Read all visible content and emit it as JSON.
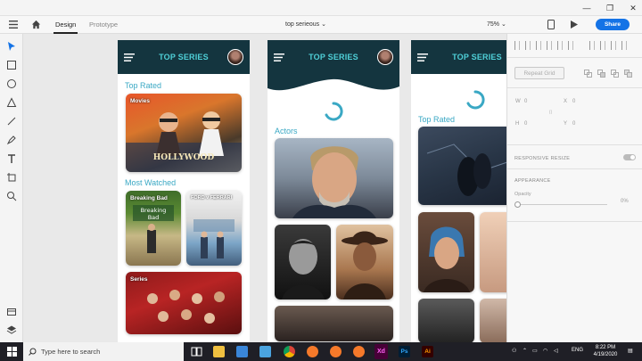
{
  "window": {
    "minimize_glyph": "—",
    "maximize_glyph": "❐",
    "close_glyph": "✕"
  },
  "app": {
    "tabs": [
      {
        "label": "Design",
        "active": true
      },
      {
        "label": "Prototype",
        "active": false
      }
    ],
    "document_title": "top serieous",
    "zoom": "75%",
    "share_label": "Share",
    "accent_color": "#1473e6"
  },
  "toolbar": {
    "tools": [
      "select-icon",
      "rectangle-icon",
      "ellipse-icon",
      "polygon-icon",
      "line-icon",
      "pen-icon",
      "text-icon",
      "artboard-icon",
      "zoom-icon",
      "plugins-icon",
      "layers-icon"
    ]
  },
  "artboards": [
    {
      "header_title": "TOP SERIES",
      "sections": [
        {
          "title": "Top Rated",
          "cards": [
            {
              "label": "Movies",
              "name": "movie-card-hollywood"
            }
          ]
        },
        {
          "title": "Most Watched",
          "cards": [
            {
              "label": "Breaking Bad",
              "name": "card-breaking-bad"
            },
            {
              "label": "FORD v FERRARI",
              "name": "card-ford-ferrari"
            }
          ]
        },
        {
          "title": "",
          "cards": [
            {
              "label": "Series",
              "name": "card-series"
            }
          ]
        }
      ]
    },
    {
      "header_title": "TOP SERIES",
      "sections": [
        {
          "title": "Actors",
          "cards": [
            {
              "label": "",
              "name": "actor-card-1"
            },
            {
              "label": "",
              "name": "actor-card-2"
            },
            {
              "label": "",
              "name": "actor-card-3"
            }
          ]
        }
      ]
    },
    {
      "header_title": "TOP SERIES",
      "sections": [
        {
          "title": "Top Rated",
          "cards": [
            {
              "label": "",
              "name": "top-rated-card-1"
            }
          ]
        }
      ]
    }
  ],
  "header_color": "#14353f",
  "title_color": "#4fd0d8",
  "section_color": "#3aa8c4",
  "right_panel": {
    "repeat_grid_label": "Repeat Grid",
    "w_label": "W",
    "w_value": "0",
    "h_label": "H",
    "h_value": "0",
    "x_label": "X",
    "x_value": "0",
    "y_label": "Y",
    "y_value": "0",
    "responsive_resize_label": "RESPONSIVE RESIZE",
    "appearance_label": "APPEARANCE",
    "opacity_label": "Opacity",
    "opacity_value": "0%"
  },
  "taskbar": {
    "search_placeholder": "Type here to search",
    "language": "ENG",
    "time": "8:22 PM",
    "date": "4/19/2020",
    "apps": [
      "task-view-icon",
      "file-explorer-icon",
      "store-icon",
      "mail-icon",
      "chrome-icon",
      "blender-icon",
      "blender-icon-2",
      "blender-icon-3",
      "adobe-xd-icon",
      "photoshop-icon",
      "illustrator-icon"
    ],
    "xd_label": "Xd",
    "ps_label": "Ps",
    "ai_label": "Ai"
  }
}
